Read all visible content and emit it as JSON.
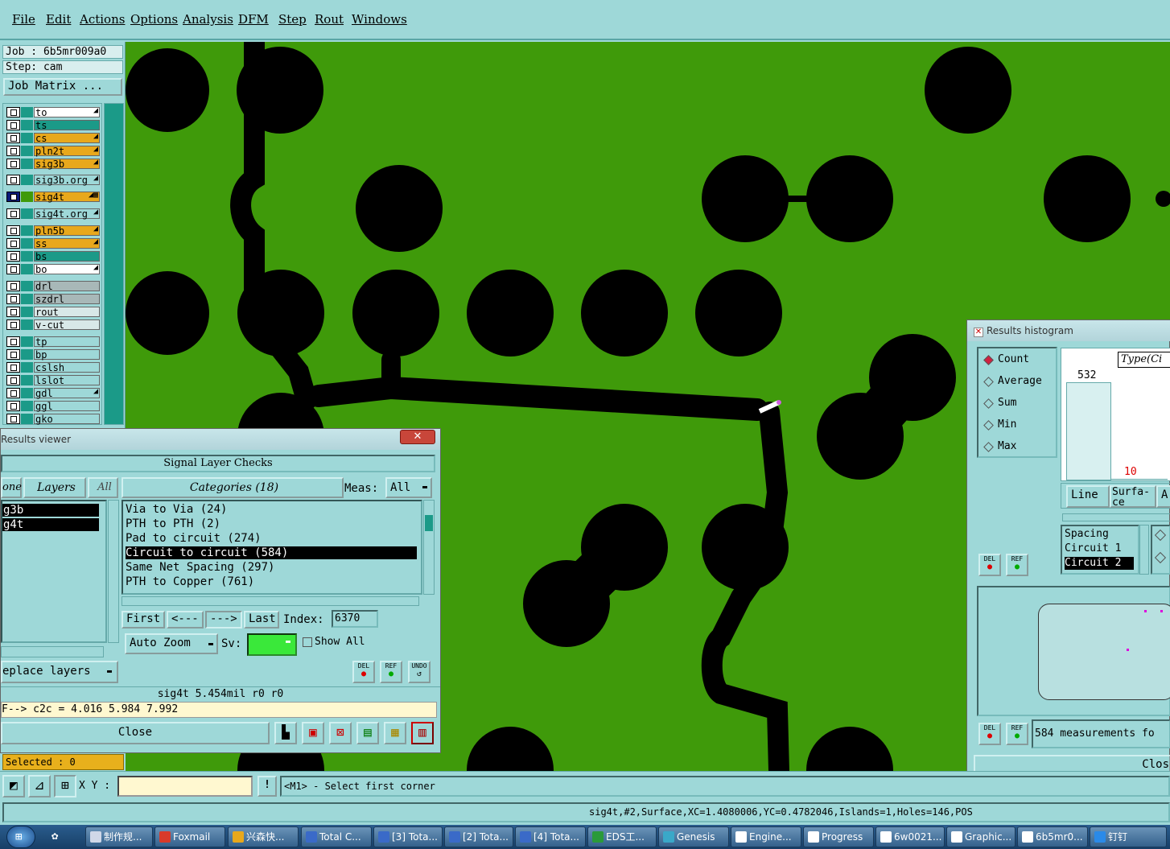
{
  "menu": [
    "File",
    "Edit",
    "Actions",
    "Options",
    "Analysis",
    "DFM",
    "Step",
    "Rout",
    "Windows"
  ],
  "job": {
    "job_line": "Job : 6b5mr009a0",
    "step_line": "Step: cam",
    "matrix_button": "Job Matrix ..."
  },
  "layers": [
    {
      "name": "to",
      "bg": "#ffffff",
      "pin": "◢"
    },
    {
      "name": "ts",
      "bg": "#1b9a88",
      "pin": ""
    },
    {
      "name": "cs",
      "bg": "#e8a81c",
      "pin": "◢"
    },
    {
      "name": "pln2t",
      "bg": "#e8a81c",
      "pin": "◢"
    },
    {
      "name": "sig3b",
      "bg": "#e8a81c",
      "pin": "◢"
    },
    {
      "name": "sig3b.org",
      "bg": "#9ed8d8",
      "pin": "◢"
    },
    {
      "name": "sig4t",
      "bg": "#e8a81c",
      "pin": "◢▦"
    },
    {
      "name": "sig4t.org",
      "bg": "#9ed8d8",
      "pin": "◢"
    },
    {
      "name": "pln5b",
      "bg": "#e8a81c",
      "pin": "◢"
    },
    {
      "name": "ss",
      "bg": "#e8a81c",
      "pin": "◢"
    },
    {
      "name": "bs",
      "bg": "#1b9a88",
      "pin": ""
    },
    {
      "name": "bo",
      "bg": "#ffffff",
      "pin": "◢"
    },
    {
      "name": "drl",
      "bg": "#a8b8b8",
      "pin": ""
    },
    {
      "name": "szdrl",
      "bg": "#a8b8b8",
      "pin": ""
    },
    {
      "name": "rout",
      "bg": "#d8e8e8",
      "pin": ""
    },
    {
      "name": "v-cut",
      "bg": "#d8e8e8",
      "pin": ""
    },
    {
      "name": "tp",
      "bg": "#9ed8d8",
      "pin": ""
    },
    {
      "name": "bp",
      "bg": "#9ed8d8",
      "pin": ""
    },
    {
      "name": "cslsh",
      "bg": "#9ed8d8",
      "pin": ""
    },
    {
      "name": "lslot",
      "bg": "#9ed8d8",
      "pin": ""
    },
    {
      "name": "gdl",
      "bg": "#9ed8d8",
      "pin": "◢"
    },
    {
      "name": "ggl",
      "bg": "#9ed8d8",
      "pin": ""
    },
    {
      "name": "gko",
      "bg": "#9ed8d8",
      "pin": ""
    }
  ],
  "results_viewer": {
    "title": "Results viewer",
    "header": "Signal Layer Checks",
    "none_label": "one",
    "layers_label": "Layers",
    "all_label": "All",
    "layer_items": [
      "g3b",
      "g4t"
    ],
    "categories_label": "Categories (18)",
    "meas_label": "Meas:",
    "meas_value": "All",
    "categories": [
      "Via to Via (24)",
      "PTH to PTH (2)",
      "Pad to circuit (274)",
      "Circuit to circuit (584)",
      "Same Net Spacing (297)",
      "PTH to Copper (761)"
    ],
    "selected_category": 3,
    "first": "First",
    "prev": "<---",
    "next": "--->",
    "last": "Last",
    "index_label": "Index:",
    "index_value": "6370",
    "auto_zoom": "Auto Zoom",
    "sv_label": "Sv:",
    "show_all": "Show All",
    "replace_layers": "eplace layers",
    "info_line": "sig4t 5.454mil  r0  r0",
    "measure_line": "F--> c2c = 4.016 5.984 7.992",
    "close": "Close",
    "btn_del": "DEL",
    "btn_ref": "REF",
    "btn_undo": "UNDO"
  },
  "histogram": {
    "title": "Results histogram",
    "options": [
      "Count",
      "Average",
      "Sum",
      "Min",
      "Max"
    ],
    "selected_option": 0,
    "type_label": "Type(Ci",
    "bars": [
      {
        "label": "532",
        "value": 532
      },
      {
        "label": "10",
        "value": 10
      }
    ],
    "tabs": [
      "Line",
      "Surfa-ce",
      "A"
    ],
    "list": [
      "Spacing",
      "Circuit 1",
      "Circuit 2"
    ],
    "selected_list": 2,
    "measurements": "584 measurements fo",
    "close": "Clos",
    "btn_del": "DEL",
    "btn_ref": "REF"
  },
  "selected": "Selected : 0",
  "cmd": {
    "xy_label": "X Y :",
    "prompt": "<M1> - Select first corner",
    "bang": "!"
  },
  "status": "sig4t,#2,Surface,XC=1.4080006,YC=0.4782046,Islands=1,Holes=146,POS",
  "taskbar": [
    {
      "label": "制作规...",
      "icon": "#d0d8e8"
    },
    {
      "label": "Foxmail",
      "icon": "#d83a2a"
    },
    {
      "label": "兴森快...",
      "icon": "#e8a81c"
    },
    {
      "label": "Total C...",
      "icon": "#3a6ac8"
    },
    {
      "label": "[3] Tota...",
      "icon": "#3a6ac8"
    },
    {
      "label": "[2] Tota...",
      "icon": "#3a6ac8"
    },
    {
      "label": "[4] Tota...",
      "icon": "#3a6ac8"
    },
    {
      "label": "EDS工...",
      "icon": "#2a9a3a"
    },
    {
      "label": "Genesis",
      "icon": "#3aa8c8"
    },
    {
      "label": "Engine...",
      "icon": "#ffffff"
    },
    {
      "label": "Progress",
      "icon": "#ffffff"
    },
    {
      "label": "6w0021...",
      "icon": "#ffffff"
    },
    {
      "label": "Graphic...",
      "icon": "#ffffff"
    },
    {
      "label": "6b5mr0...",
      "icon": "#ffffff"
    },
    {
      "label": "钉钉",
      "icon": "#2a8ae8"
    }
  ]
}
